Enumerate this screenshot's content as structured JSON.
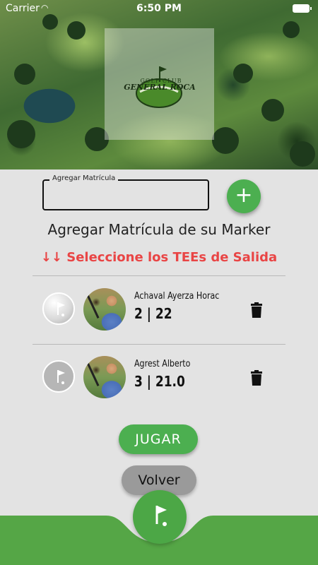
{
  "statusbar": {
    "carrier": "Carrier",
    "time": "6:50 PM"
  },
  "logo": {
    "top_text": "GOLF CLUB",
    "name": "GENERAL ROCA"
  },
  "form": {
    "input_label": "Agregar Matrícula",
    "input_value": "",
    "add_label": "+"
  },
  "title": "Agregar Matrícula de su Marker",
  "tees_text": "↓↓ Seleccione los TEEs de Salida",
  "players": [
    {
      "name": "Achaval Ayerza Horac",
      "stats": "2 | 22",
      "tee": "white"
    },
    {
      "name": "Agrest Alberto",
      "stats": "3 | 21.0",
      "tee": "grey"
    }
  ],
  "buttons": {
    "play": "JUGAR",
    "back": "Volver"
  },
  "colors": {
    "accent": "#4caf50",
    "warning": "#e94545",
    "background": "#e3e3e3"
  },
  "icons": {
    "add": "plus-icon",
    "delete": "trash-icon",
    "tee": "golf-flag-icon",
    "fab": "golf-flag-icon"
  }
}
